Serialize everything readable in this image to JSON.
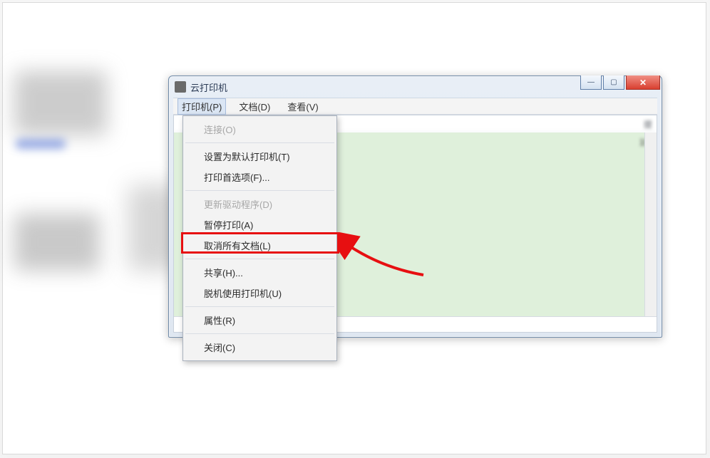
{
  "window": {
    "title": "云打印机",
    "buttons": {
      "min": "—",
      "max": "▢",
      "close": "✕"
    }
  },
  "menubar": {
    "printer": "打印机(P)",
    "document": "文档(D)",
    "view": "查看(V)"
  },
  "columns": {
    "c5_visible": "提",
    "time_visible": "19:"
  },
  "printer_menu": {
    "connect": "连接(O)",
    "set_default": "设置为默认打印机(T)",
    "preferences": "打印首选项(F)...",
    "update_driver": "更新驱动程序(D)",
    "pause": "暂停打印(A)",
    "cancel_all": "取消所有文档(L)",
    "sharing": "共享(H)...",
    "offline": "脱机使用打印机(U)",
    "properties": "属性(R)",
    "close": "关闭(C)"
  },
  "annotation": {
    "highlighted_item": "cancel_all",
    "arrow_points_to": "cancel_all"
  }
}
